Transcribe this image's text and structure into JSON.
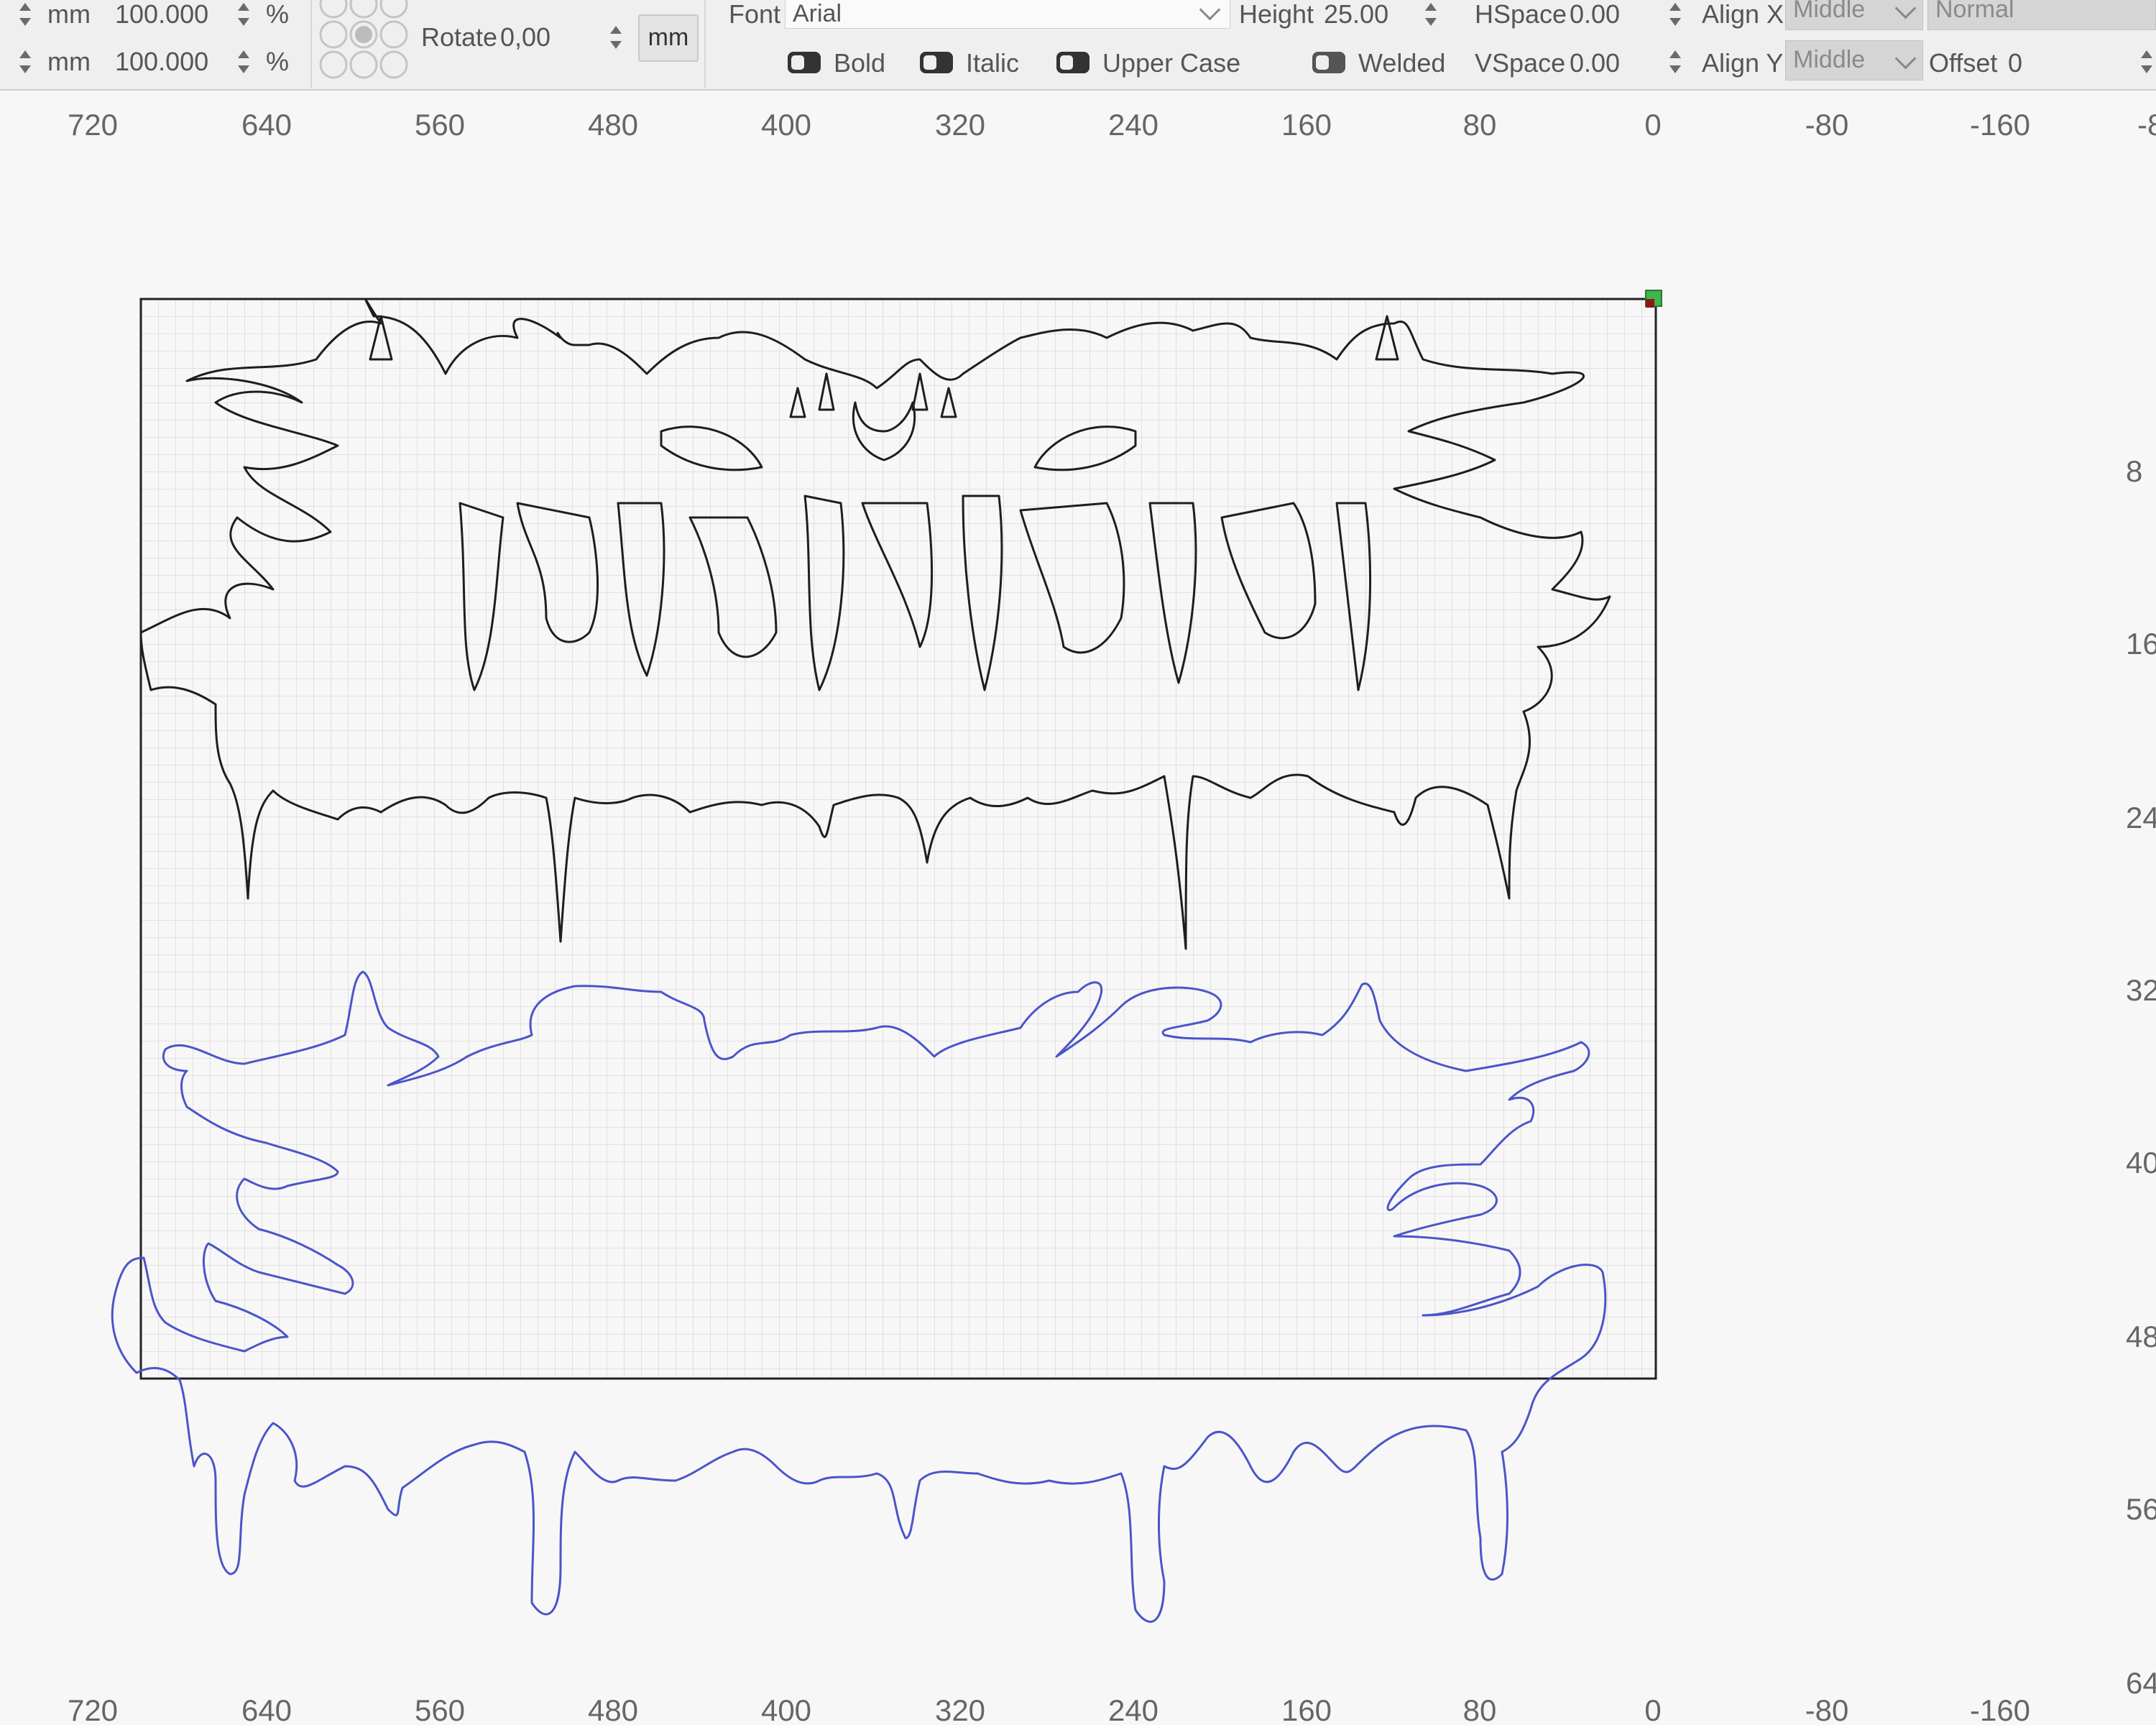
{
  "toolbar": {
    "width_unit": "mm",
    "width_value": "100.000",
    "width_pct": "%",
    "height_unit": "mm",
    "height_value": "100.000",
    "height_pct": "%",
    "rotate_label": "Rotate",
    "rotate_value": "0,00",
    "unit_button": "mm",
    "font_label": "Font",
    "font_value": "Arial",
    "height_label": "Height",
    "text_height_value": "25.00",
    "hspace_label": "HSpace",
    "hspace_value": "0.00",
    "vspace_label": "VSpace",
    "vspace_value": "0.00",
    "align_x_label": "Align X",
    "align_x_value": "Middle",
    "align_y_label": "Align Y",
    "align_y_value": "Middle",
    "mode_value": "Normal",
    "offset_label": "Offset",
    "offset_value": "0",
    "bold_label": "Bold",
    "italic_label": "Italic",
    "upper_label": "Upper Case",
    "welded_label": "Welded"
  },
  "ruler": {
    "top_labels": [
      "720",
      "640",
      "560",
      "480",
      "400",
      "320",
      "240",
      "160",
      "80",
      "0",
      "-80",
      "-160",
      "-8"
    ],
    "bottom_labels": [
      "720",
      "640",
      "560",
      "480",
      "400",
      "320",
      "240",
      "160",
      "80",
      "0",
      "-80",
      "-160"
    ],
    "side_labels": [
      "8",
      "16",
      "24",
      "32",
      "40",
      "48",
      "56",
      "64"
    ]
  },
  "colors": {
    "artwork_black": "#1a1a1a",
    "artwork_blue": "#4a55c9",
    "grid": "#d8d8d8",
    "handle_green": "#3fb54a",
    "handle_red": "#8b1a1a"
  },
  "icons": {
    "spinner": "spinner-arrows-icon",
    "anchor": "anchor-grid-icon",
    "dropdown": "chevron-down-icon",
    "toggle": "toggle-switch-icon"
  }
}
